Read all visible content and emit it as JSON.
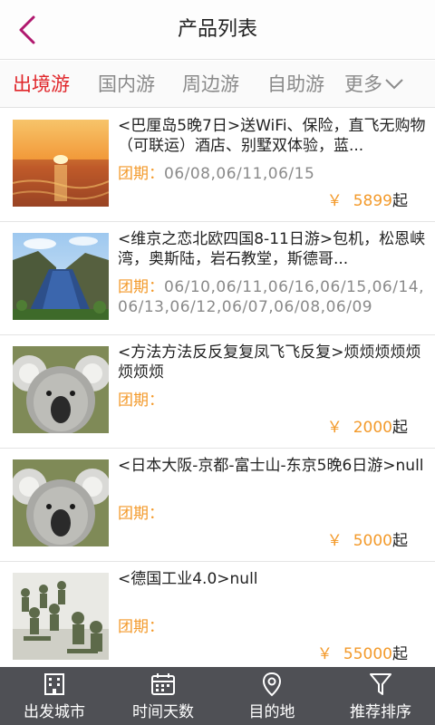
{
  "header": {
    "title": "产品列表",
    "back_icon": "chevron-left-icon",
    "accent": "#b0186e"
  },
  "tabs": [
    {
      "label": "出境游",
      "active": true
    },
    {
      "label": "国内游",
      "active": false
    },
    {
      "label": "周边游",
      "active": false
    },
    {
      "label": "自助游",
      "active": false
    },
    {
      "label": "更多",
      "active": false,
      "icon": "chevron-down-icon"
    }
  ],
  "products": [
    {
      "title": "<巴厘岛5晚7日>送WiFi、保险，直飞无购物（可联运）酒店、别墅双体验，蓝...",
      "dates_label": "团期：",
      "dates": "06/08,06/11,06/15",
      "price_prefix": "￥",
      "price": "5899",
      "price_suffix": "起",
      "image": "sunset-sea"
    },
    {
      "title": "<维京之恋北欧四国8-11日游>包机，松恩峡湾，奥斯陆，岩石教堂，斯德哥...",
      "dates_label": "团期：",
      "dates": "06/10,06/11,06/16,06/15,06/14,06/13,06/12,06/07,06/08,06/09",
      "price_prefix": "",
      "price": "",
      "price_suffix": "",
      "image": "fjord"
    },
    {
      "title": "<方法方法反反复复凤飞飞反复>烦烦烦烦烦烦烦烦",
      "dates_label": "团期：",
      "dates": "",
      "price_prefix": "￥",
      "price": "2000",
      "price_suffix": "起",
      "image": "koala"
    },
    {
      "title": "<日本大阪-京都-富士山-东京5晚6日游>null",
      "dates_label": "团期：",
      "dates": "",
      "price_prefix": "￥",
      "price": "5000",
      "price_suffix": "起",
      "image": "koala"
    },
    {
      "title": "<德国工业4.0>null",
      "dates_label": "团期：",
      "dates": "",
      "price_prefix": "￥",
      "price": "55000",
      "price_suffix": "起",
      "image": "toy-soldiers"
    }
  ],
  "bottom_bar": [
    {
      "label": "出发城市",
      "icon": "building-icon"
    },
    {
      "label": "时间天数",
      "icon": "calendar-icon"
    },
    {
      "label": "目的地",
      "icon": "location-pin-icon"
    },
    {
      "label": "推荐排序",
      "icon": "filter-icon"
    }
  ],
  "colors": {
    "active_tab": "#e0262a",
    "price": "#f39a2b",
    "bottom_bar": "#4f5055"
  }
}
